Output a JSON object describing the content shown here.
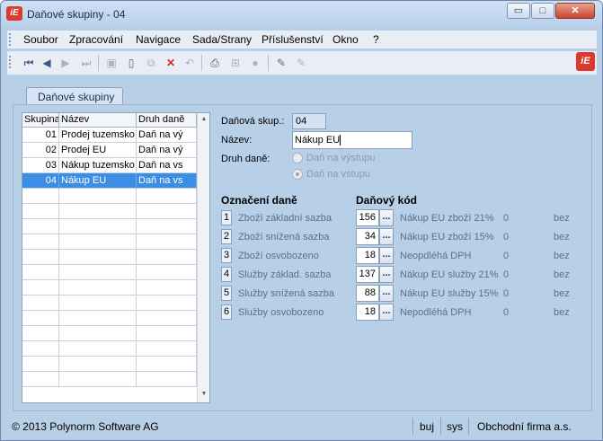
{
  "window": {
    "title": "Daňové skupiny - 04",
    "app_icon_text": "iE"
  },
  "window_controls": {
    "minimize": "▭",
    "maximize": "□",
    "close": "✕"
  },
  "menu": [
    "Soubor",
    "Zpracování",
    "Navigace",
    "Sada/Strany",
    "Příslušenství",
    "Okno",
    "?"
  ],
  "toolbar": {
    "icons": [
      "first-record-icon",
      "previous-record-icon",
      "next-record-icon",
      "last-record-icon",
      "save-icon",
      "new-document-icon",
      "copy-icon",
      "delete-icon",
      "undo-icon",
      "print-icon",
      "structure-icon",
      "disabled-circle-icon",
      "edit-pen-icon",
      "edit-pen-disabled-icon"
    ],
    "logo_text": "iE"
  },
  "tab": {
    "label": "Daňové skupiny"
  },
  "grid": {
    "columns": [
      "Skupina",
      "Název",
      "Druh daně"
    ],
    "rows": [
      {
        "skupina": "01",
        "nazev": "Prodej tuzemsko",
        "druh": "Daň na vý"
      },
      {
        "skupina": "02",
        "nazev": "Prodej EU",
        "druh": "Daň na vý"
      },
      {
        "skupina": "03",
        "nazev": "Nákup tuzemsko",
        "druh": "Daň na vs"
      },
      {
        "skupina": "04",
        "nazev": "Nákup EU",
        "druh": "Daň na vs"
      }
    ],
    "selected_index": 3
  },
  "form": {
    "skupina_label": "Daňová skup.:",
    "skupina_value": "04",
    "nazev_label": "Název:",
    "nazev_value": "Nákup EU",
    "druh_label": "Druh daně:",
    "druh_option_1": "Daň na výstupu",
    "druh_option_2": "Daň na vstupu",
    "druh_selected": "Daň na vstupu"
  },
  "tax_section": {
    "header_oznaceni": "Označení daně",
    "header_kod": "Daňový kód",
    "dots_label": "...",
    "rows": [
      {
        "num": "1",
        "name": "Zboží základní sazba",
        "code": "156",
        "desc": "Nákup EU zboží 21%",
        "zero": "0",
        "bez": "bez"
      },
      {
        "num": "2",
        "name": "Zboží snížená sazba",
        "code": "34",
        "desc": "Nákup EU zboží 15%",
        "zero": "0",
        "bez": "bez"
      },
      {
        "num": "3",
        "name": "Zboží osvobozeno",
        "code": "18",
        "desc": "Neopdléhá DPH",
        "zero": "0",
        "bez": "bez"
      },
      {
        "num": "4",
        "name": "Služby základ. sazba",
        "code": "137",
        "desc": "Nákup EU služby 21%",
        "zero": "0",
        "bez": "bez"
      },
      {
        "num": "5",
        "name": "Služby snížená sazba",
        "code": "88",
        "desc": "Nákup EU služby 15%",
        "zero": "0",
        "bez": "bez"
      },
      {
        "num": "6",
        "name": "Služby osvobozeno",
        "code": "18",
        "desc": "Nepodléhá DPH",
        "zero": "0",
        "bez": "bez"
      }
    ]
  },
  "statusbar": {
    "copyright": "© 2013 Polynorm Software AG",
    "user": "buj",
    "db": "sys",
    "firm": "Obchodní firma a.s."
  },
  "colors": {
    "selection": "#3b8ee4",
    "brand": "#d93a2b",
    "panel": "#b8cfe8"
  }
}
